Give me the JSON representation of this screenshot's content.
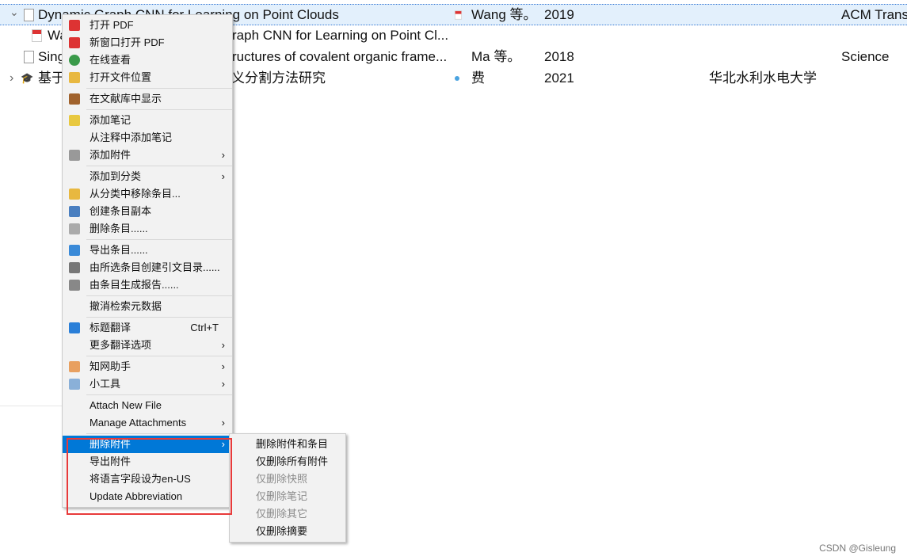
{
  "rows": [
    {
      "title": "Dynamic Graph CNN for Learning on Point Clouds",
      "title_tail": "",
      "creator": "Wang 等。",
      "year": "2019",
      "publisher": "",
      "publication": "ACM Trans",
      "icon": "document-icon",
      "expanded": true,
      "selected": true
    },
    {
      "title": "Wa",
      "title_tail": "raph CNN for Learning on Point Cl...",
      "creator": "",
      "year": "",
      "publisher": "",
      "publication": "",
      "icon": "pdf-icon"
    },
    {
      "title": "Sing",
      "title_tail": "ructures of covalent organic frame...",
      "creator": "Ma 等。",
      "year": "2018",
      "publisher": "",
      "publication": "Science",
      "icon": "document-icon"
    },
    {
      "title": "基于",
      "title_tail": "义分割方法研究",
      "creator": "费",
      "year": "2021",
      "publisher": "华北水利水电大学",
      "publication": "",
      "icon": "thesis-icon",
      "collapsed": true
    }
  ],
  "menu": [
    {
      "label": "打开 PDF",
      "icon": "pdf-icon",
      "color": "#d33"
    },
    {
      "label": "新窗口打开 PDF",
      "icon": "pdf-icon",
      "color": "#d33"
    },
    {
      "label": "在线查看",
      "icon": "globe-icon",
      "color": "#3a9a4a"
    },
    {
      "label": "打开文件位置",
      "icon": "folder-icon",
      "color": "#e8b840"
    },
    {
      "sep": true
    },
    {
      "label": "在文献库中显示",
      "icon": "library-icon",
      "color": "#a0622c"
    },
    {
      "sep": true
    },
    {
      "label": "添加笔记",
      "icon": "note-add-icon",
      "color": "#e8c840"
    },
    {
      "label": "从注释中添加笔记"
    },
    {
      "label": "添加附件",
      "icon": "paperclip-icon",
      "color": "#999",
      "submenu": true
    },
    {
      "sep": true
    },
    {
      "label": "添加到分类",
      "submenu": true
    },
    {
      "label": "从分类中移除条目...",
      "icon": "folder-remove-icon",
      "color": "#e8b840"
    },
    {
      "label": "创建条目副本",
      "icon": "duplicate-icon",
      "color": "#4a7fc0"
    },
    {
      "label": "删除条目......",
      "icon": "trash-icon",
      "color": "#aaa"
    },
    {
      "sep": true
    },
    {
      "label": "导出条目......",
      "icon": "export-icon",
      "color": "#3a8ad8"
    },
    {
      "label": "由所选条目创建引文目录......",
      "icon": "bibliography-icon",
      "color": "#777"
    },
    {
      "label": "由条目生成报告......",
      "icon": "report-icon",
      "color": "#888"
    },
    {
      "sep": true
    },
    {
      "label": "撤消检索元数据"
    },
    {
      "sep": true
    },
    {
      "label": "标题翻译",
      "icon": "translate-icon",
      "color": "#2a7fd8",
      "shortcut": "Ctrl+T"
    },
    {
      "label": "更多翻译选项",
      "submenu": true
    },
    {
      "sep": true
    },
    {
      "label": "知网助手",
      "icon": "wrench-icon",
      "color": "#e8a060",
      "submenu": true
    },
    {
      "label": "小工具",
      "icon": "wrench-icon",
      "color": "#8ab0d8",
      "submenu": true
    },
    {
      "sep": true
    },
    {
      "label": "Attach New File"
    },
    {
      "label": "Manage Attachments",
      "submenu": true
    },
    {
      "sep": true
    },
    {
      "label": "删除附件",
      "submenu": true,
      "highlighted": true
    },
    {
      "label": "导出附件"
    },
    {
      "label": "将语言字段设为en-US"
    },
    {
      "label": "Update Abbreviation"
    }
  ],
  "submenu": [
    {
      "label": "删除附件和条目"
    },
    {
      "label": "仅删除所有附件"
    },
    {
      "label": "仅删除快照",
      "disabled": true
    },
    {
      "label": "仅删除笔记",
      "disabled": true
    },
    {
      "label": "仅删除其它",
      "disabled": true
    },
    {
      "label": "仅删除摘要"
    }
  ],
  "watermark": "CSDN @Gisleung",
  "colors": {
    "highlight": "#0078d7",
    "selection": "#e3f0fc",
    "annotation_box": "#e83a3a"
  }
}
